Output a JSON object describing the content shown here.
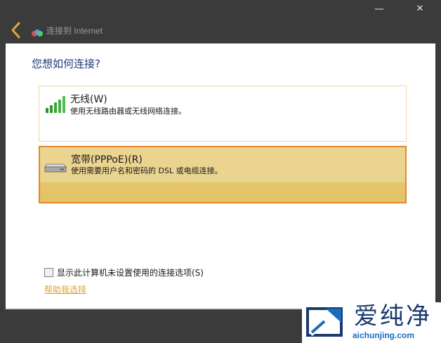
{
  "window": {
    "title": "连接到 Internet",
    "minimize_glyph": "—",
    "close_glyph": "✕"
  },
  "main": {
    "heading": "您想如何连接?",
    "options": [
      {
        "label": "无线(W)",
        "description": "使用无线路由器或无线网络连接。",
        "icon": "wireless-signal-icon",
        "selected": false
      },
      {
        "label": "宽带(PPPoE)(R)",
        "description": "使用需要用户名和密码的 DSL 或电缆连接。",
        "icon": "broadband-modem-icon",
        "selected": true
      }
    ],
    "show_unavailable_checkbox": {
      "label": "显示此计算机未设置使用的连接选项(S)",
      "checked": false
    },
    "help_link": "帮助我选择"
  },
  "watermark": {
    "name": "爱纯净",
    "url": "aichunjing.com"
  },
  "colors": {
    "heading": "#1e3a78",
    "selected_border": "#e8852a",
    "selected_fill": "#e8d38f",
    "help_link": "#d9a63b"
  }
}
